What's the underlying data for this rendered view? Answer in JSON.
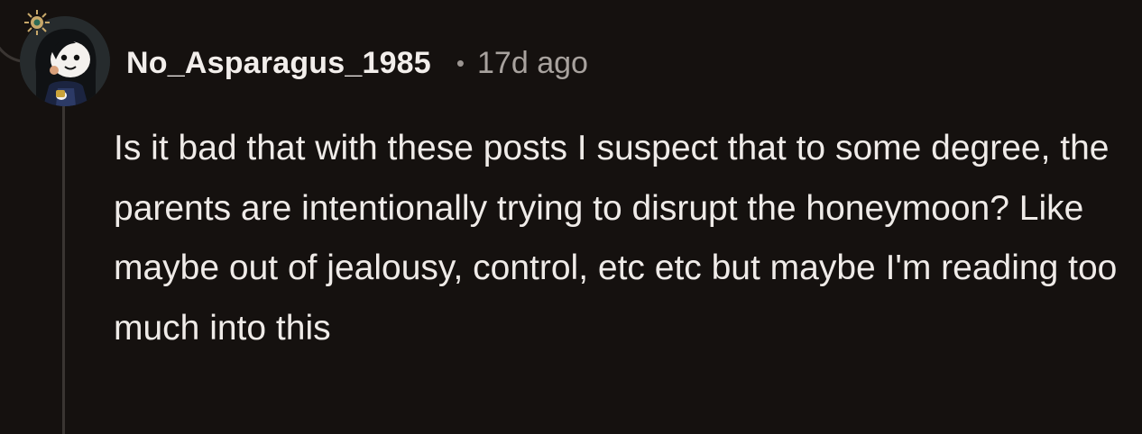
{
  "comment": {
    "author": "No_Asparagus_1985",
    "separator": "•",
    "time_ago": "17d ago",
    "body": "Is it bad that with these posts I suspect that to some degree, the parents are intentionally trying to disrupt the honeymoon? Like maybe out of jealousy, control, etc etc but maybe I'm reading too much into this"
  },
  "avatar": {
    "icon": "snoo-avatar-icon",
    "badge_icon": "sparkle-badge-icon"
  },
  "colors": {
    "background": "#15110f",
    "text": "#efebe8",
    "muted": "#a8a29e",
    "thread_line": "#3a3532"
  }
}
